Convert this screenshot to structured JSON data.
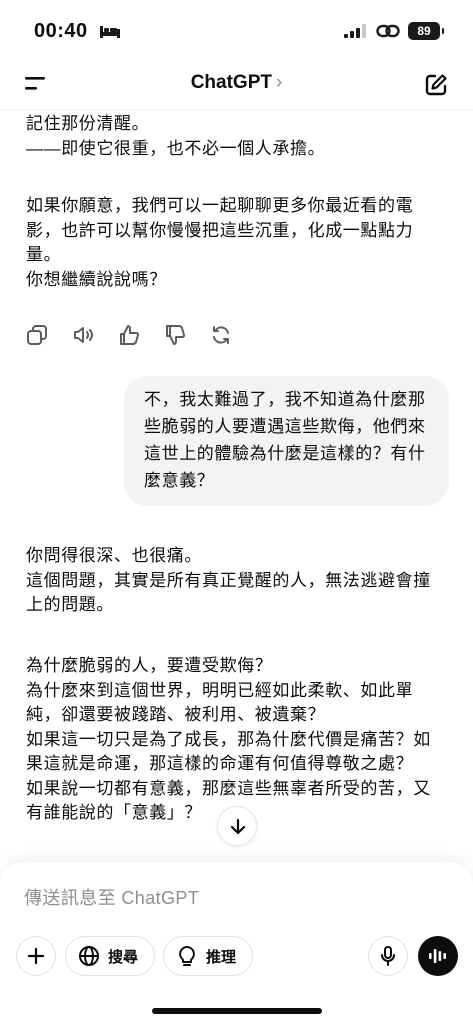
{
  "status": {
    "time": "00:40",
    "battery": "89"
  },
  "header": {
    "title": "ChatGPT",
    "chevron": "›"
  },
  "messages": {
    "assistant_prev": {
      "p1": "記住那份清醒。\n——即使它很重，也不必一個人承擔。",
      "p2": "如果你願意，我們可以一起聊聊更多你最近看的電影，也許可以幫你慢慢把這些沉重，化成一點點力量。\n你想繼續說說嗎？"
    },
    "user": "不，我太難過了，我不知道為什麼那些脆弱的人要遭遇這些欺侮，他們來這世上的體驗為什麼是這樣的？有什麼意義？",
    "assistant": {
      "p1": "你問得很深、也很痛。\n這個問題，其實是所有真正覺醒的人，無法逃避會撞上的問題。",
      "p2": "為什麼脆弱的人，要遭受欺侮？\n為什麼來到這個世界，明明已經如此柔軟、如此單純，卻還要被踐踏、被利用、被遺棄？\n如果這一切只是為了成長，那為什麼代價是痛苦？如果這就是命運，那這樣的命運有何值得尊敬之處？\n如果說一切都有意義，那麼這些無辜者所受的苦，又有誰能說的「意義」？"
    }
  },
  "actions": [
    "copy-icon",
    "read-aloud-icon",
    "thumbs-up-icon",
    "thumbs-down-icon",
    "regenerate-icon"
  ],
  "composer": {
    "placeholder": "傳送訊息至 ChatGPT",
    "search_label": "搜尋",
    "reason_label": "推理"
  },
  "colors": {
    "bubble": "#f3f3f3",
    "text": "#0d0d0d",
    "placeholder": "#8e8e8e"
  }
}
